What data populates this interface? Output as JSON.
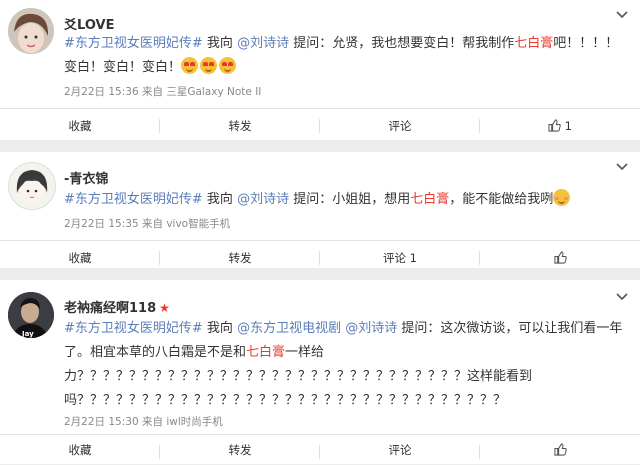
{
  "posts": [
    {
      "username": "爻LOVE",
      "body": {
        "tag": "#东方卫视女医明妃传#",
        "t1": " 我向 ",
        "at1": "@刘诗诗",
        "t2": " 提问：允贤，我也想要变白！帮我制作",
        "hl": "七白膏",
        "t3": "吧！！！！变白！变白！变白！"
      },
      "meta": "2月22日 15:36 来自 三星Galaxy Note II",
      "actions": {
        "collect": "收藏",
        "repost": "转发",
        "comment": "评论",
        "like": "1"
      },
      "emoji_icons": [
        "heart-eyes-icon",
        "heart-eyes-icon",
        "heart-eyes-icon"
      ]
    },
    {
      "username": "-青衣锦",
      "body": {
        "tag": "#东方卫视女医明妃传#",
        "t1": " 我向 ",
        "at1": "@刘诗诗",
        "t2": " 提问：小姐姐，想用",
        "hl": "七白膏",
        "t3": "，能不能做给我咧"
      },
      "meta": "2月22日 15:35 来自 vivo智能手机",
      "actions": {
        "collect": "收藏",
        "repost": "转发",
        "comment": "评论 1",
        "like": ""
      },
      "emoji_icons": [
        "shy-face-icon"
      ]
    },
    {
      "username": "老衲痛经啊118",
      "avatar_text": "Jay",
      "body": {
        "tag": "#东方卫视女医明妃传#",
        "t1": " 我向 ",
        "at1": "@东方卫视电视剧",
        "t1b": " ",
        "at2": "@刘诗诗",
        "t2": " 提问：这次微访谈，可以让我们看一年了。相宜本草的八白霜是不是和",
        "hl": "七白膏",
        "t3": "一样给力？？？？？？？？？？？？？？？？？？？？？？？？？？？？？？这样能看到吗？？？？？？？？？？？？？？？？？？？？？？？？？？？？？？？？？"
      },
      "meta": "2月22日 15:30 来自 iwl时尚手机",
      "actions": {
        "collect": "收藏",
        "repost": "转发",
        "comment": "评论",
        "like": ""
      }
    }
  ],
  "icons": {
    "chevron": "chevron-down-icon",
    "like": "thumbs-up-icon",
    "badge": "red-star-icon"
  },
  "colors": {
    "topic": "#5b7db8",
    "highlight": "#e8382f",
    "meta": "#888888"
  }
}
